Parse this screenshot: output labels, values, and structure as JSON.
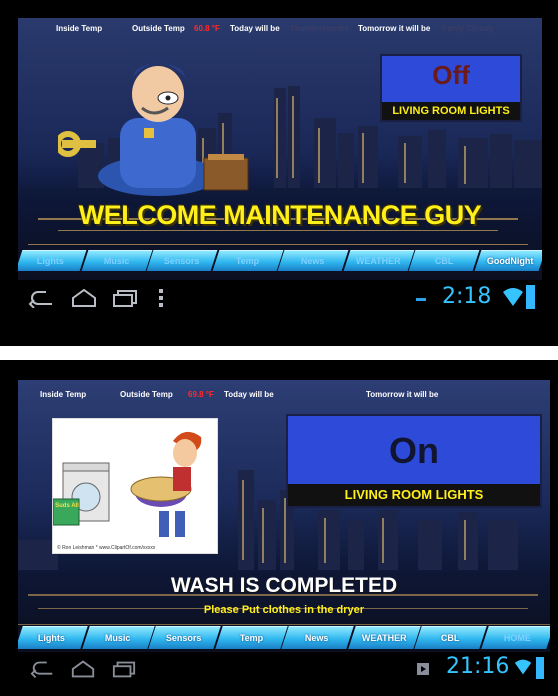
{
  "screen_top": {
    "status": {
      "inside_temp_label": "Inside Temp",
      "outside_temp_label": "Outside Temp",
      "outside_temp_value": "60.8 °F",
      "today_label": "Today will be",
      "today_value": "Thunderstorms",
      "tomorrow_label": "Tomorrow it will be",
      "tomorrow_value": "Partly Cloudy"
    },
    "light": {
      "state": "Off",
      "label": "LIVING ROOM LIGHTS"
    },
    "banner": "WELCOME MAINTENANCE GUY",
    "tabs": [
      "Lights",
      "Music",
      "Sensors",
      "Temp",
      "News",
      "WEATHER",
      "CBL",
      "GoodNight"
    ],
    "clock": "2:18"
  },
  "screen_bottom": {
    "status": {
      "inside_temp_label": "Inside Temp",
      "outside_temp_label": "Outside Temp",
      "outside_temp_value": "69.8 °F",
      "today_label": "Today will be",
      "tomorrow_label": "Tomorrow it will be"
    },
    "light": {
      "state": "On",
      "label": "LIVING ROOM LIGHTS"
    },
    "cartoon_caption": "© Ron Leishman * www.ClipartOf.com/xxxxx",
    "cartoon_box_text": "Suds All",
    "banner": "WASH IS COMPLETED",
    "subbanner": "Please Put clothes in the dryer",
    "tabs": [
      "Lights",
      "Music",
      "Sensors",
      "Temp",
      "News",
      "WEATHER",
      "CBL",
      "HOME"
    ],
    "clock": "21:16"
  },
  "colors": {
    "light_box": "#2d4bd8",
    "label_yellow": "#ffef1a",
    "off_text": "#6a1a1a",
    "on_text": "#121530",
    "tab_blue": "#2fb7ef",
    "clock_blue": "#36c4ff"
  }
}
